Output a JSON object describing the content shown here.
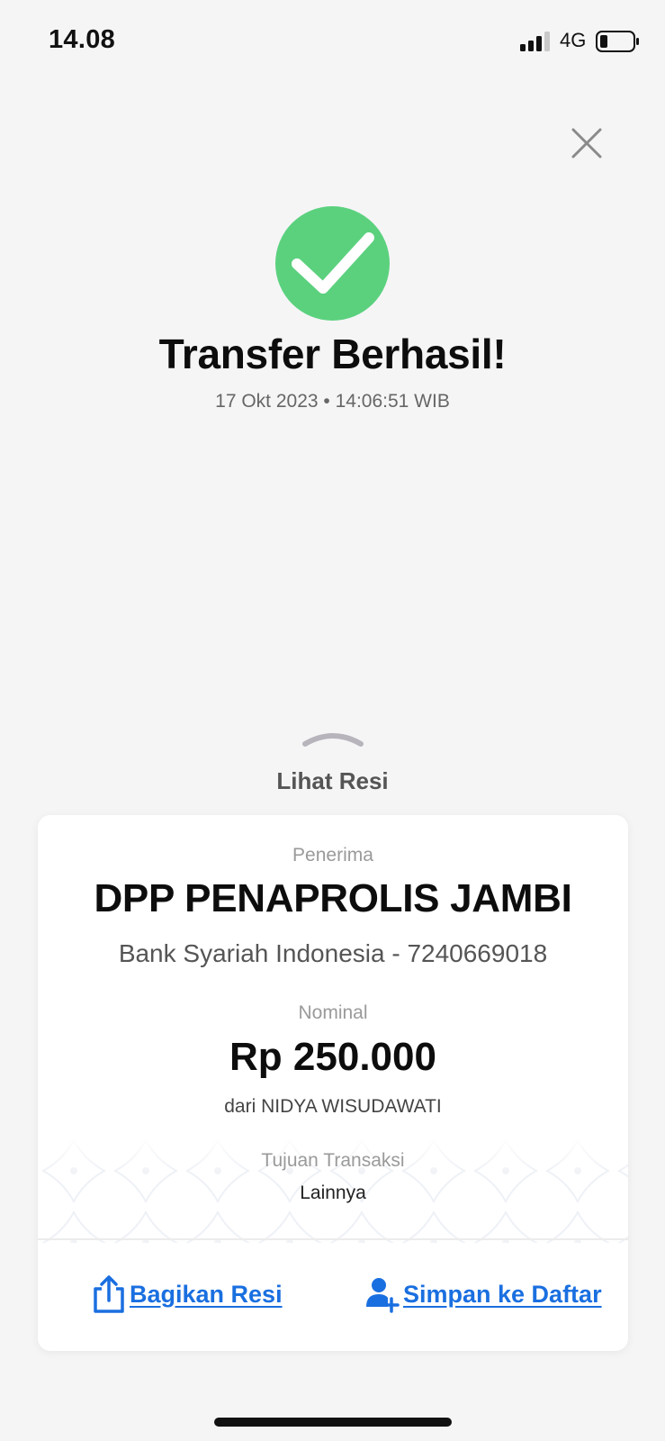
{
  "status_bar": {
    "time": "14.08",
    "network": "4G",
    "signal_icon": "signal-bars-icon",
    "battery_icon": "battery-low-icon"
  },
  "header": {
    "close_icon": "close-icon"
  },
  "result": {
    "icon": "checkmark-circle-icon",
    "title": "Transfer Berhasil!",
    "timestamp": "17 Okt 2023 • 14:06:51 WIB",
    "accent_color": "#5bd17e"
  },
  "receipt_toggle": {
    "icon": "chevron-up-handle-icon",
    "label": "Lihat Resi"
  },
  "receipt": {
    "recipient_label": "Penerima",
    "recipient_name": "DPP PENAPROLIS JAMBI",
    "bank_info": "Bank Syariah Indonesia - 7240669018",
    "amount_label": "Nominal",
    "amount": "Rp 250.000",
    "sender": "dari NIDYA WISUDAWATI",
    "purpose_label": "Tujuan Transaksi",
    "purpose_value": "Lainnya"
  },
  "actions": {
    "share_label": "Bagikan Resi",
    "share_icon": "share-icon",
    "save_label": "Simpan ke Daftar",
    "save_icon": "add-user-icon",
    "link_color": "#1a6fe0"
  }
}
